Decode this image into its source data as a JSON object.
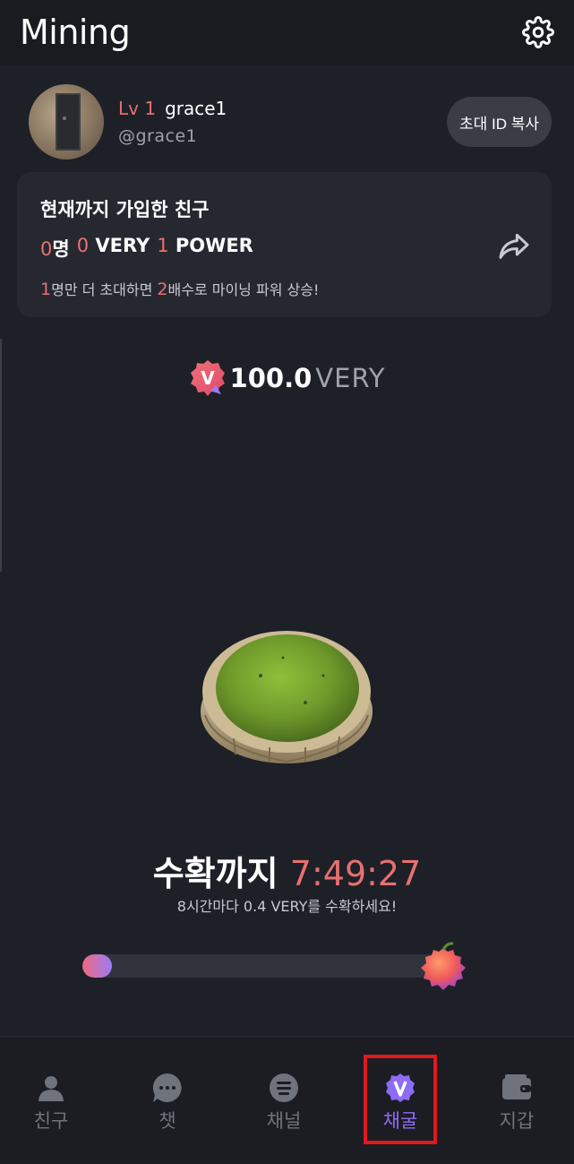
{
  "header": {
    "title": "Mining",
    "settings_icon": "gear-icon"
  },
  "profile": {
    "level": "Lv 1",
    "username": "grace1",
    "handle": "@grace1",
    "invite_button": "초대 ID 복사"
  },
  "friends_card": {
    "title": "현재까지 가입한 친구",
    "friends_count": "0",
    "friends_unit": "명",
    "very_count": "0",
    "very_unit": "VERY",
    "power_count": "1",
    "power_unit": "POWER",
    "hint_count1": "1",
    "hint_text1": "명만 더 초대하면 ",
    "hint_count2": "2",
    "hint_text2": "배수로 마이닝 파워 상승!",
    "share_icon": "share-icon"
  },
  "balance": {
    "badge": "V",
    "amount": "100.0",
    "unit": "VERY"
  },
  "timer": {
    "label": "수확까지 ",
    "time": "7:49:27",
    "subtitle": "8시간마다 0.4 VERY를 수확하세요!"
  },
  "progress": {
    "fraction": 0.08
  },
  "nav": [
    {
      "label": "친구",
      "icon": "person-icon",
      "active": false
    },
    {
      "label": "챗",
      "icon": "chat-icon",
      "active": false
    },
    {
      "label": "채널",
      "icon": "channel-icon",
      "active": false
    },
    {
      "label": "채굴",
      "icon": "v-mining-icon",
      "active": true
    },
    {
      "label": "지갑",
      "icon": "wallet-icon",
      "active": false
    }
  ],
  "colors": {
    "background": "#1e2028",
    "accent_red": "#e8706f",
    "accent_purple": "#8d6cf5",
    "highlight": "#e0191c"
  }
}
